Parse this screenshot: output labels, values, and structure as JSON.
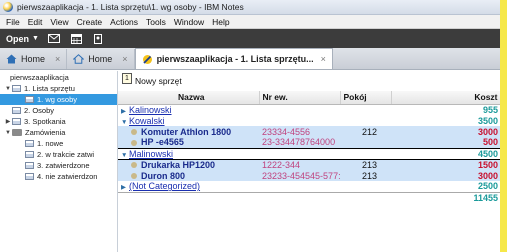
{
  "window": {
    "title": "pierwszaaplikacja - 1. Lista sprzętu\\1. wg osoby - IBM Notes"
  },
  "menu": [
    "File",
    "Edit",
    "View",
    "Create",
    "Actions",
    "Tools",
    "Window",
    "Help"
  ],
  "toolbar": {
    "open_label": "Open"
  },
  "tabs": [
    {
      "label": "Home",
      "icon": "home-icon"
    },
    {
      "label": "Home",
      "icon": "home-outline-icon"
    },
    {
      "label": "pierwszaaplikacja - 1. Lista sprzętu...",
      "icon": "notes-db-icon"
    }
  ],
  "nav": {
    "title": "pierwszaaplikacja",
    "items": [
      {
        "label": "1. Lista sprzętu",
        "level": 1,
        "expanded": true
      },
      {
        "label": "1. wg osoby",
        "level": 2,
        "selected": true
      },
      {
        "label": "2. Osoby",
        "level": 1
      },
      {
        "label": "3. Spotkania",
        "level": 1,
        "collapsed": true
      },
      {
        "label": "Zamówienia",
        "level": 1,
        "folder": true,
        "expanded": true
      },
      {
        "label": "1. nowe",
        "level": 2
      },
      {
        "label": "2. w trakcie zatwi",
        "level": 2
      },
      {
        "label": "3. zatwierdzone",
        "level": 2
      },
      {
        "label": "4. nie zatwierdzon",
        "level": 2
      }
    ]
  },
  "action_bar": {
    "new_label": "Nowy sprzęt",
    "icon_text": "1"
  },
  "view": {
    "columns": [
      "Nazwa",
      "Nr ew.",
      "Pokój",
      "Koszt"
    ],
    "rows": [
      {
        "kind": "category",
        "twisty": "▶",
        "name": "Kalinowski",
        "koszt": "955"
      },
      {
        "kind": "category",
        "twisty": "▼",
        "name": "Kowalski",
        "koszt": "3500"
      },
      {
        "kind": "doc",
        "name": "Komuter Athlon 1800",
        "nr": "23334-4556",
        "pokoj": "212",
        "koszt": "3000"
      },
      {
        "kind": "doc",
        "name": "HP -e4565",
        "nr": "23-334478764000",
        "pokoj": "",
        "koszt": "500"
      },
      {
        "kind": "category",
        "twisty": "▼",
        "name": "Malinowski",
        "koszt": "4500",
        "boxed": true
      },
      {
        "kind": "doc",
        "name": "Drukarka HP1200",
        "nr": "1222-344",
        "pokoj": "213",
        "koszt": "1500"
      },
      {
        "kind": "doc",
        "name": "Duron 800",
        "nr": "23233-454545-577:",
        "pokoj": "213",
        "koszt": "3000"
      },
      {
        "kind": "category",
        "twisty": "▶",
        "name": "(Not Categorized)",
        "koszt": "2500"
      }
    ],
    "total": "11455"
  }
}
